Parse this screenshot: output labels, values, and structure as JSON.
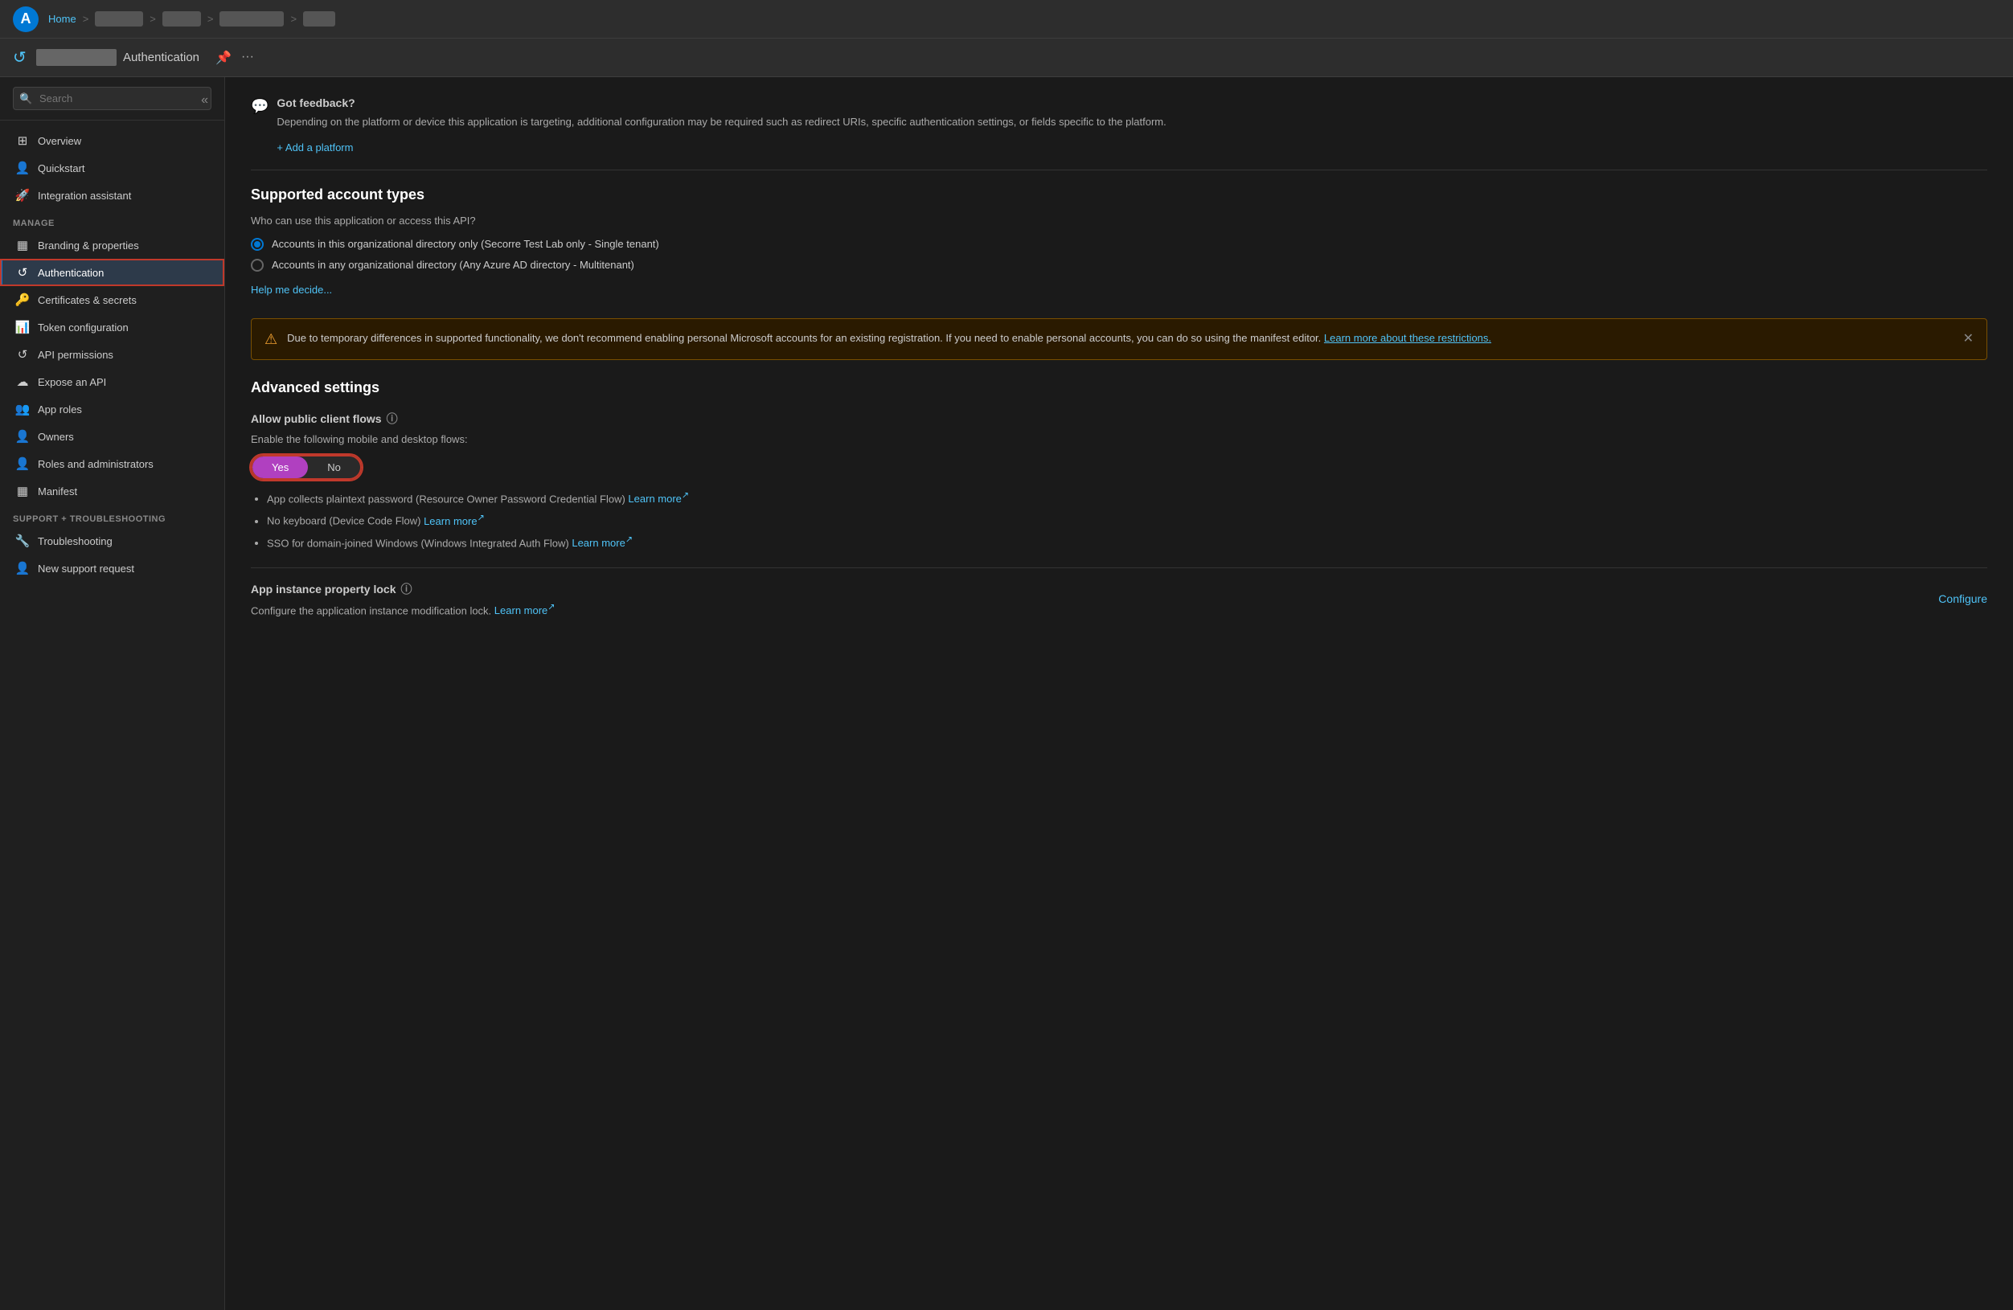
{
  "topbar": {
    "home_label": "Home",
    "breadcrumb_items": [
      "blurred1",
      "blurred2",
      "blurred3",
      "blurred4"
    ]
  },
  "titlebar": {
    "icon": "↺",
    "app_name_blurred": "APP NAME",
    "suffix": "Authentication",
    "pin_icon": "📌",
    "more_icon": "···"
  },
  "sidebar": {
    "search_placeholder": "Search",
    "collapse_label": "«",
    "manage_label": "Manage",
    "nav_items": [
      {
        "id": "overview",
        "label": "Overview",
        "icon": "⊞"
      },
      {
        "id": "quickstart",
        "label": "Quickstart",
        "icon": "👤"
      },
      {
        "id": "integration-assistant",
        "label": "Integration assistant",
        "icon": "🚀"
      }
    ],
    "manage_items": [
      {
        "id": "branding",
        "label": "Branding & properties",
        "icon": "▦"
      },
      {
        "id": "authentication",
        "label": "Authentication",
        "icon": "↺",
        "active": true
      },
      {
        "id": "certificates",
        "label": "Certificates & secrets",
        "icon": "🔑"
      },
      {
        "id": "token-config",
        "label": "Token configuration",
        "icon": "📊"
      },
      {
        "id": "api-permissions",
        "label": "API permissions",
        "icon": "↺"
      },
      {
        "id": "expose-api",
        "label": "Expose an API",
        "icon": "☁"
      },
      {
        "id": "app-roles",
        "label": "App roles",
        "icon": "👥"
      },
      {
        "id": "owners",
        "label": "Owners",
        "icon": "👤"
      },
      {
        "id": "roles-admins",
        "label": "Roles and administrators",
        "icon": "👤"
      },
      {
        "id": "manifest",
        "label": "Manifest",
        "icon": "▦"
      }
    ],
    "support_label": "Support + Troubleshooting",
    "support_items": [
      {
        "id": "troubleshooting",
        "label": "Troubleshooting",
        "icon": "🔧"
      },
      {
        "id": "new-support",
        "label": "New support request",
        "icon": "👤"
      }
    ]
  },
  "content": {
    "feedback": {
      "icon": "💬",
      "title": "Got feedback?",
      "description": "Depending on the platform or device this application is targeting, additional configuration may be required such as redirect URIs, specific authentication settings, or fields specific to the platform."
    },
    "add_platform_label": "+ Add a platform",
    "supported_accounts": {
      "title": "Supported account types",
      "question": "Who can use this application or access this API?",
      "options": [
        {
          "id": "single-tenant",
          "label": "Accounts in this organizational directory only (Secorre Test Lab only - Single tenant)",
          "selected": true
        },
        {
          "id": "multi-tenant",
          "label": "Accounts in any organizational directory (Any Azure AD directory - Multitenant)",
          "selected": false
        }
      ],
      "help_link": "Help me decide..."
    },
    "warning": {
      "text": "Due to temporary differences in supported functionality, we don't recommend enabling personal Microsoft accounts for an existing registration. If you need to enable personal accounts, you can do so using the manifest editor.",
      "link_text": "Learn more about these restrictions."
    },
    "advanced_settings": {
      "title": "Advanced settings",
      "allow_public_client": {
        "label": "Allow public client flows",
        "sublabel": "Enable the following mobile and desktop flows:",
        "toggle_yes": "Yes",
        "toggle_no": "No",
        "yes_active": true
      },
      "flow_items": [
        {
          "text": "App collects plaintext password (Resource Owner Password Credential Flow)",
          "link": "Learn more",
          "has_external": true
        },
        {
          "text": "No keyboard (Device Code Flow)",
          "link": "Learn more",
          "has_external": true
        },
        {
          "text": "SSO for domain-joined Windows (Windows Integrated Auth Flow)",
          "link": "Learn more",
          "has_external": true
        }
      ],
      "app_instance_lock": {
        "title": "App instance property lock",
        "description": "Configure the application instance modification lock.",
        "learn_more": "Learn more",
        "configure_label": "Configure"
      }
    }
  }
}
